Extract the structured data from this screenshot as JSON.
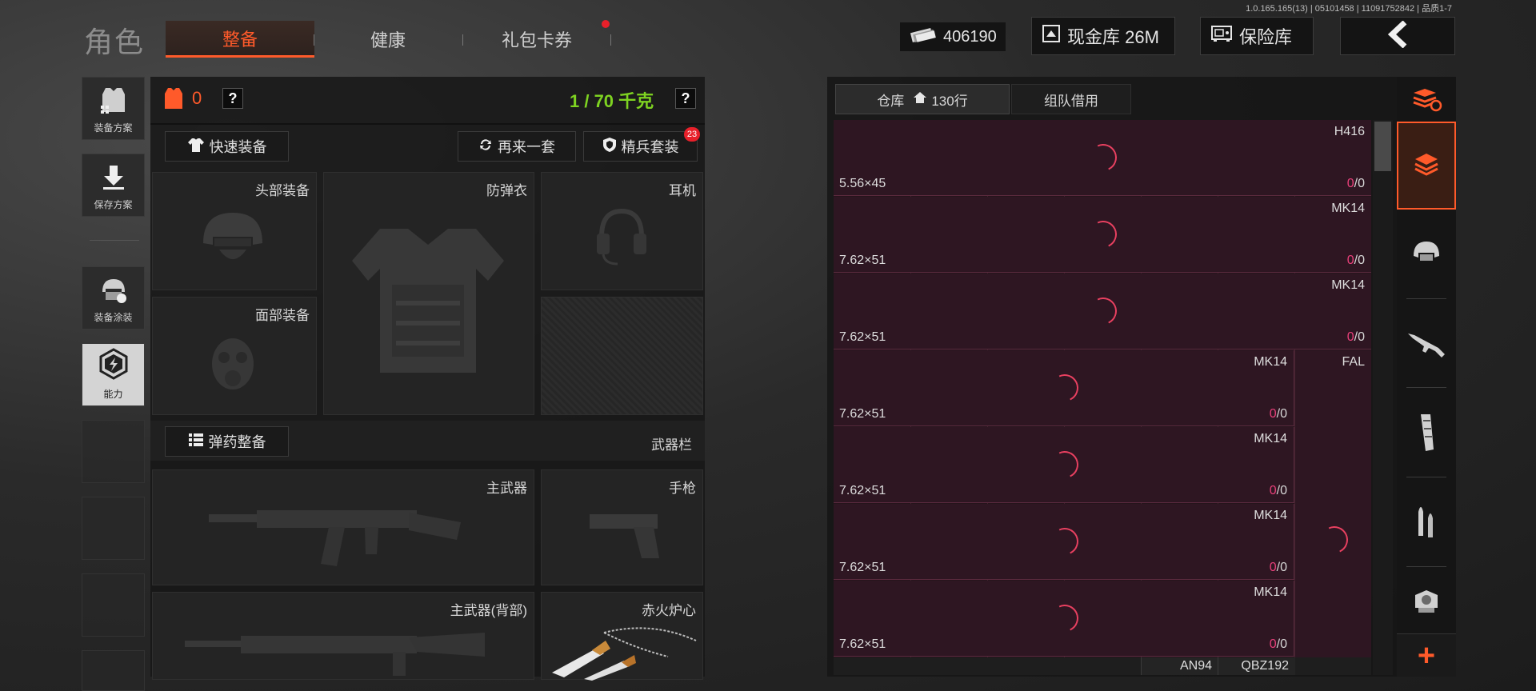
{
  "version_info": "1.0.165.165(13) | 05101458 | 11091752842 | 品质1-7",
  "header": {
    "title": "角色",
    "tabs": [
      {
        "label": "整备",
        "active": true
      },
      {
        "label": "健康",
        "active": false
      },
      {
        "label": "礼包卡券",
        "active": false,
        "notification": true
      }
    ],
    "currency": {
      "icon": "cash-stack-icon",
      "value": "406190"
    },
    "cash_vault_label": "现金库 26M",
    "safe_label": "保险库",
    "back_icon": "chevron-left-icon"
  },
  "left_rail": {
    "items": [
      {
        "label": "装备方案",
        "icon": "vest-grid-icon"
      },
      {
        "label": "保存方案",
        "icon": "download-icon"
      },
      {
        "label": "装备涂装",
        "icon": "helmet-paint-icon"
      },
      {
        "label": "能力",
        "icon": "lightning-hexagon-icon",
        "active": true
      }
    ]
  },
  "equipment": {
    "armor_count": "0",
    "weight": "1 / 70 千克",
    "help_label": "?",
    "quick_equip_label": "快速装备",
    "another_set_label": "再来一套",
    "elite_set_label": "精兵套装",
    "elite_badge": "23",
    "slots": {
      "head": "头部装备",
      "armor": "防弹衣",
      "headset": "耳机",
      "face": "面部装备"
    },
    "ammo_label": "弹药整备",
    "weapon_bar_label": "武器栏",
    "weapon_slots": {
      "primary": "主武器",
      "pistol": "手枪",
      "primary_back": "主武器(背部)",
      "melee": "赤火炉心"
    }
  },
  "warehouse": {
    "tab_warehouse": "仓库",
    "rows_count": "130行",
    "tab_team_borrow": "组队借用",
    "items": [
      {
        "name": "H416",
        "caliber": "5.56×45",
        "count_a": "0",
        "count_b": "/0"
      },
      {
        "name": "MK14",
        "caliber": "7.62×51",
        "count_a": "0",
        "count_b": "/0"
      },
      {
        "name": "MK14",
        "caliber": "7.62×51",
        "count_a": "0",
        "count_b": "/0"
      },
      {
        "name": "MK14",
        "caliber": "7.62×51",
        "count_a": "0",
        "count_b": "/0",
        "side_name": "FAL"
      },
      {
        "name": "MK14",
        "caliber": "7.62×51",
        "count_a": "0",
        "count_b": "/0"
      },
      {
        "name": "MK14",
        "caliber": "7.62×51",
        "count_a": "0",
        "count_b": "/0"
      },
      {
        "name": "MK14",
        "caliber": "7.62×51",
        "count_a": "0",
        "count_b": "/0"
      }
    ],
    "bottom_names": [
      "AN94",
      "QBZ192"
    ]
  },
  "right_rail": {
    "icons": [
      "stack-refresh-icon",
      "layers-swap-icon",
      "helmet-icon",
      "rifle-icon",
      "magazine-icon",
      "ammo-icon",
      "scope-icon"
    ],
    "add_label": "+"
  },
  "colors": {
    "accent": "#ff5a2a",
    "count_pink": "#e8407a",
    "weight_green": "#7ed321"
  }
}
